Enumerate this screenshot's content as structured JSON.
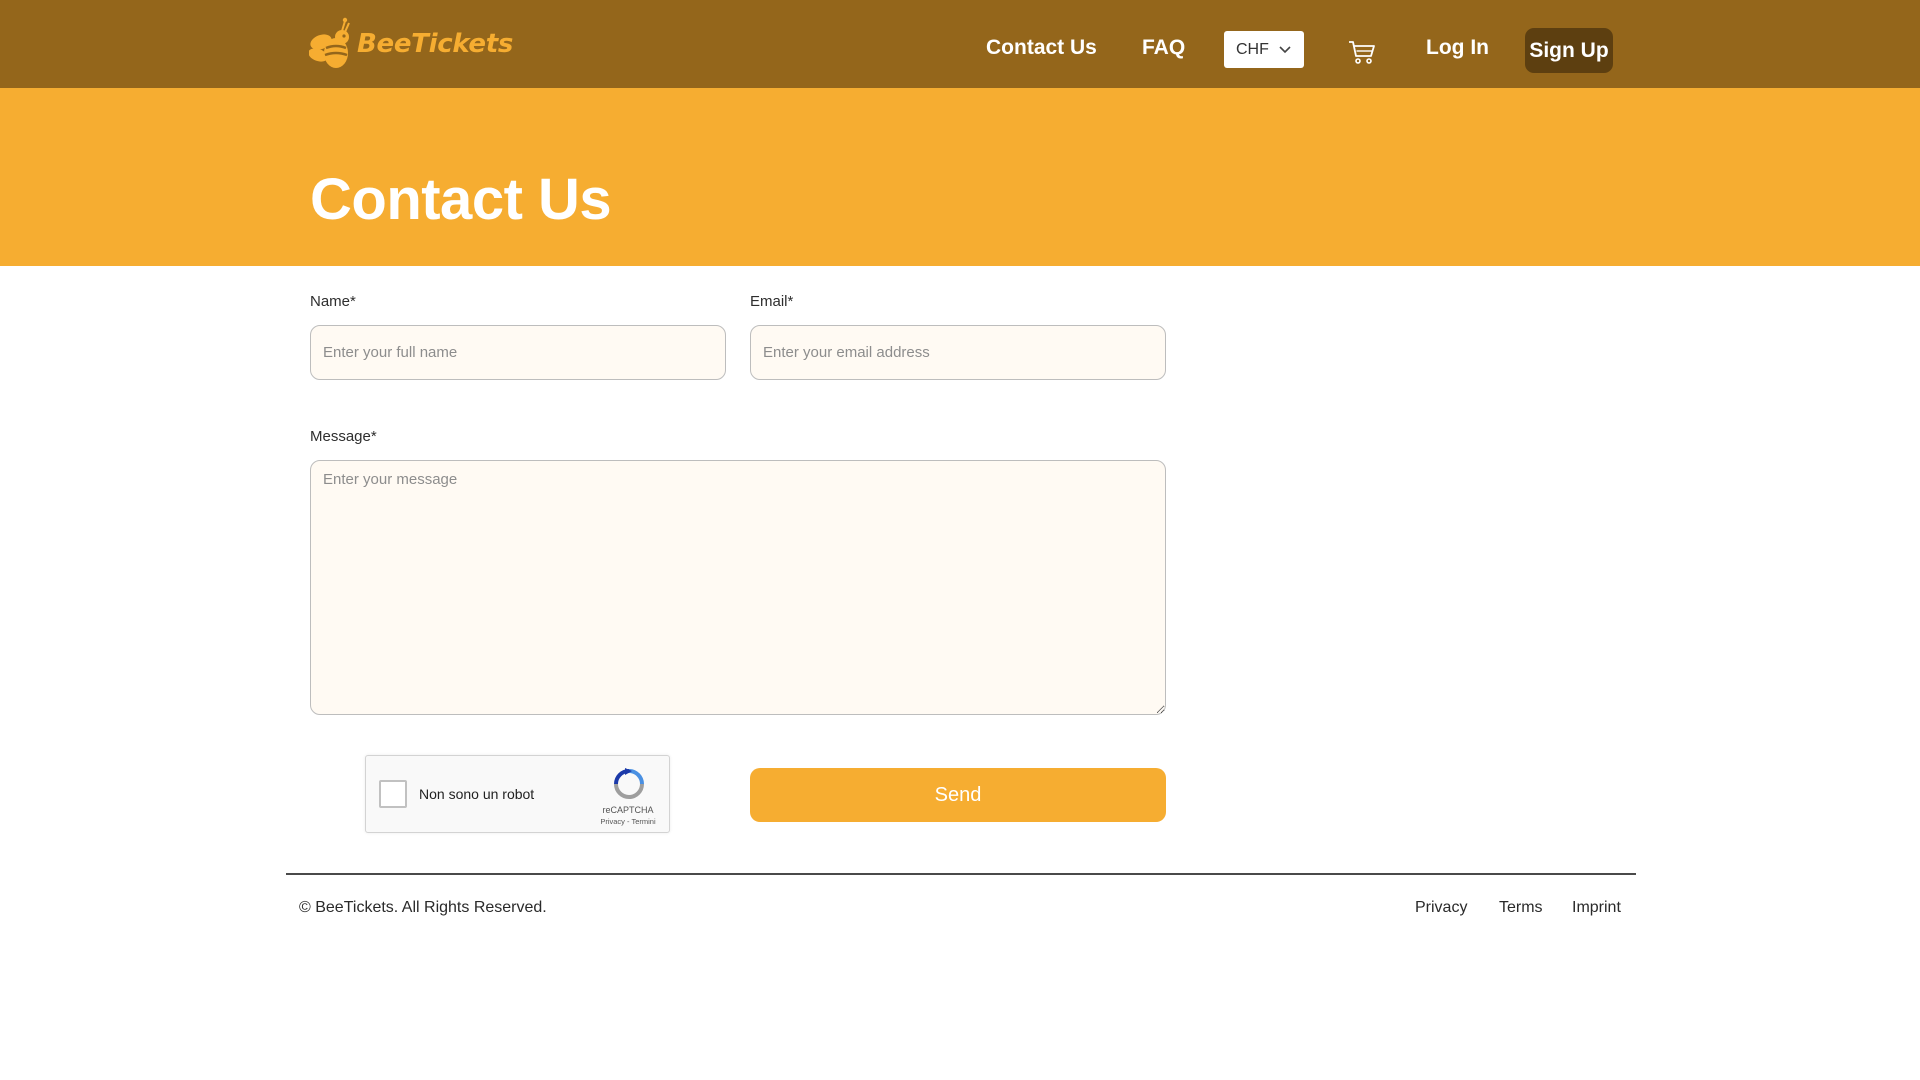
{
  "header": {
    "logo_text": "BeeTickets",
    "nav": {
      "contact": "Contact Us",
      "faq": "FAQ",
      "login": "Log In",
      "signup": "Sign Up"
    },
    "currency": "CHF",
    "cart_icon": "cart-icon"
  },
  "hero": {
    "title": "Contact Us"
  },
  "form": {
    "name_label": "Name*",
    "name_placeholder": "Enter your full name",
    "email_label": "Email*",
    "email_placeholder": "Enter your email address",
    "message_label": "Message*",
    "message_placeholder": "Enter your message",
    "send_label": "Send"
  },
  "recaptcha": {
    "label": "Non sono un robot",
    "brand": "reCAPTCHA",
    "links": "Privacy - Termini"
  },
  "footer": {
    "copyright": "© BeeTickets. All Rights Reserved.",
    "links": {
      "privacy": "Privacy",
      "terms": "Terms",
      "imprint": "Imprint"
    }
  },
  "colors": {
    "header_bg": "#94661b",
    "accent": "#f6ad31",
    "signup_bg": "#5d3f10",
    "input_bg": "#fffaf3"
  }
}
